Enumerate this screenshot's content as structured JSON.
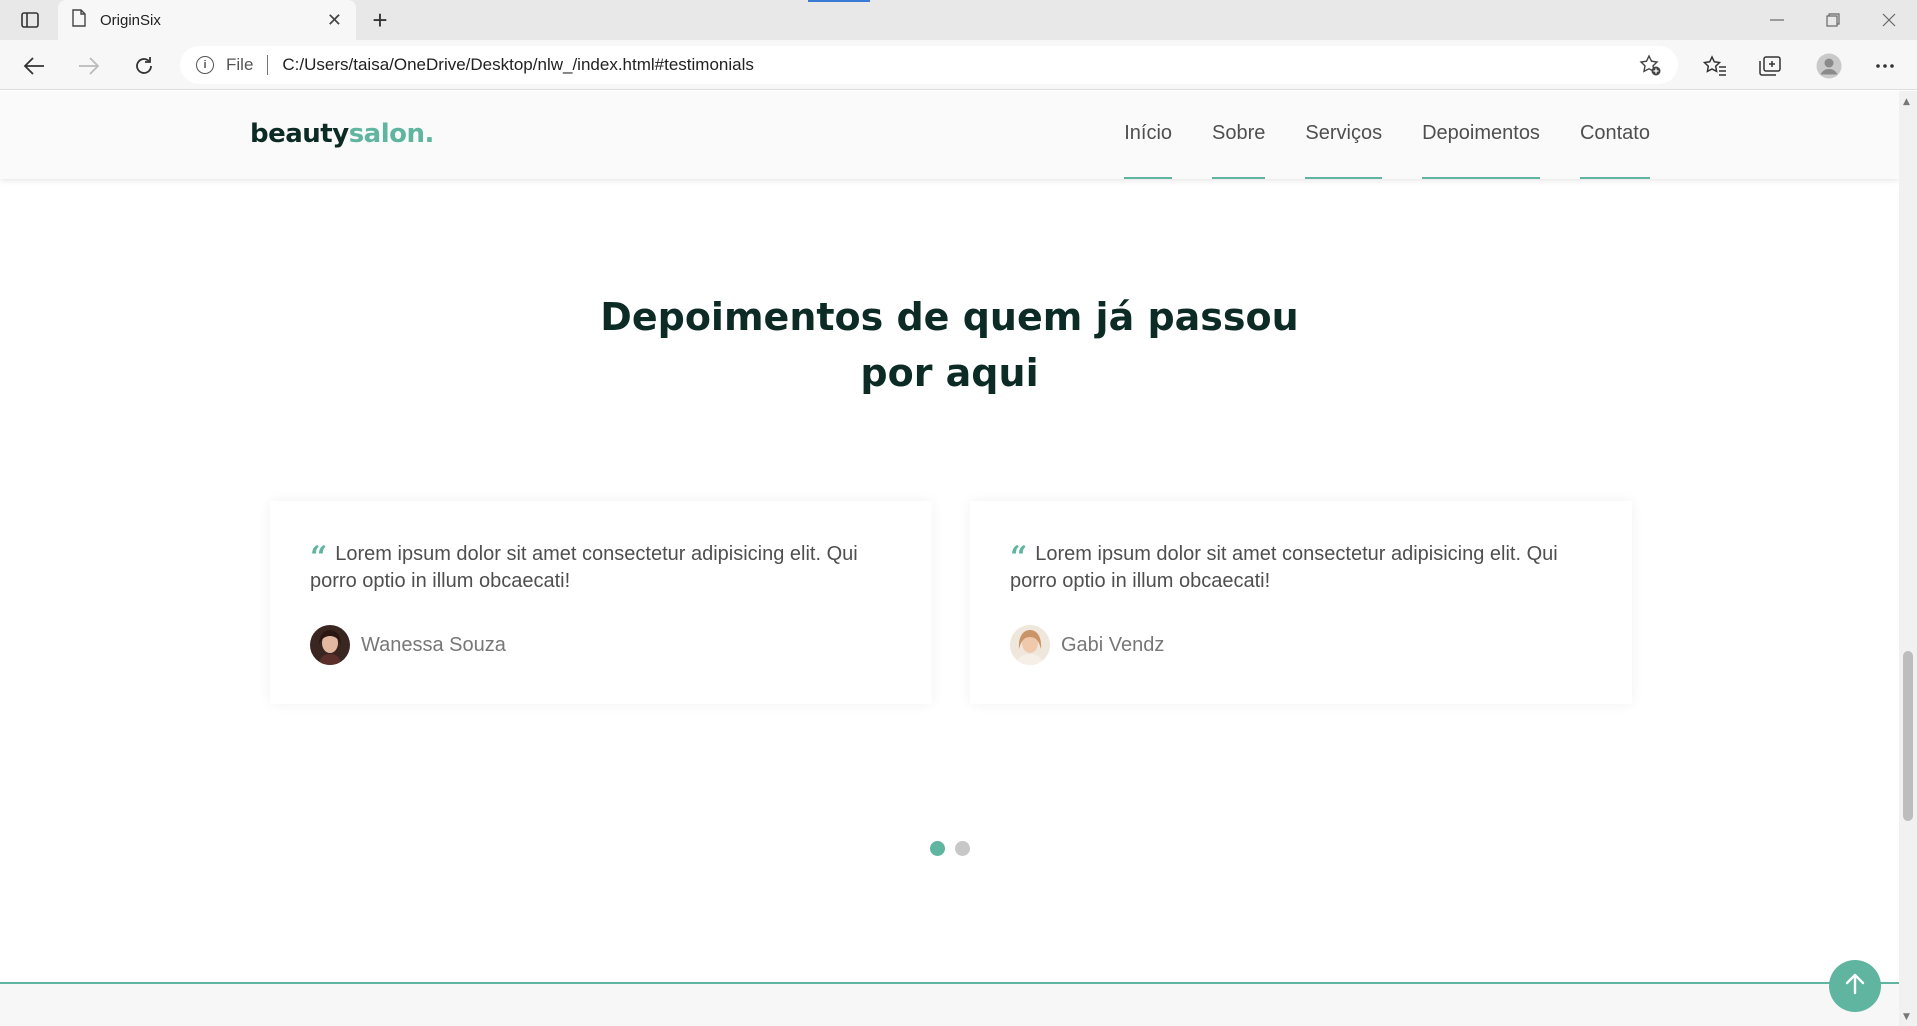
{
  "browser": {
    "tab_title": "OriginSix",
    "tab_close": "✕",
    "new_tab": "+",
    "scheme": "File",
    "url": "C:/Users/taisa/OneDrive/Desktop/nlw_/index.html#testimonials"
  },
  "site": {
    "logo_main": "beauty",
    "logo_accent": "salon",
    "logo_dot": ".",
    "nav": [
      "Início",
      "Sobre",
      "Serviços",
      "Depoimentos",
      "Contato"
    ]
  },
  "testimonials": {
    "title_line1": "Depoimentos de quem já passou",
    "title_line2": "por aqui",
    "quote_mark": "“",
    "cards": [
      {
        "quote": "Lorem ipsum dolor sit amet consectetur adipisicing elit. Qui porro optio in illum obcaecati!",
        "author": "Wanessa Souza"
      },
      {
        "quote": "Lorem ipsum dolor sit amet consectetur adipisicing elit. Qui porro optio in illum obcaecati!",
        "author": "Gabi Vendz"
      }
    ],
    "active_slide": 1,
    "slide_count": 2
  },
  "colors": {
    "accent": "#5fb59f",
    "title": "#0d2b25",
    "text": "#4f4f4f"
  },
  "icons": [
    "tab-actions-icon",
    "page-icon",
    "back-arrow-icon",
    "forward-arrow-icon",
    "reload-icon",
    "info-icon",
    "add-favorite-icon",
    "favorites-icon",
    "collections-icon",
    "profile-icon",
    "more-icon",
    "arrow-up-icon"
  ]
}
